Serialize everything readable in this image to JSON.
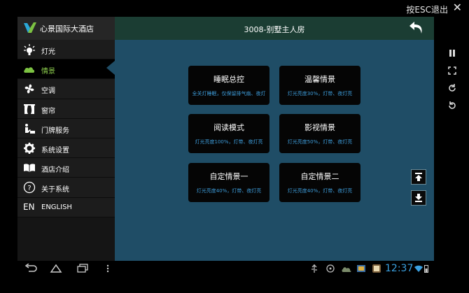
{
  "emulator": {
    "esc_hint": "按ESC退出",
    "close_glyph": "✕"
  },
  "brand": {
    "name": "心景国际大酒店",
    "logo": "v-logo-icon"
  },
  "header": {
    "room_title": "3008-别墅主人房"
  },
  "menu": {
    "active_index": 1,
    "items": [
      {
        "label": "灯光",
        "icon": "bulb-icon"
      },
      {
        "label": "情景",
        "icon": "scene-cloud-icon"
      },
      {
        "label": "空调",
        "icon": "fan-icon"
      },
      {
        "label": "窗帘",
        "icon": "curtain-icon"
      },
      {
        "label": "门牌服务",
        "icon": "doorbell-icon"
      },
      {
        "label": "系统设置",
        "icon": "gear-icon"
      },
      {
        "label": "酒店介绍",
        "icon": "book-icon"
      },
      {
        "label": "关于系统",
        "icon": "help-icon"
      },
      {
        "label": "ENGLISH",
        "icon": "EN"
      }
    ]
  },
  "scenes": [
    {
      "title": "睡眠总控",
      "desc": "全关灯睡眠，仅保留排气扇、夜灯"
    },
    {
      "title": "温馨情景",
      "desc": "灯光亮度30%，灯带、夜灯亮"
    },
    {
      "title": "阅读模式",
      "desc": "灯光亮度100%，灯带、夜灯亮"
    },
    {
      "title": "影视情景",
      "desc": "灯光亮度50%，灯带、夜灯亮"
    },
    {
      "title": "自定情景一",
      "desc": "灯光亮度40%，灯带、夜灯亮"
    },
    {
      "title": "自定情景二",
      "desc": "灯光亮度40%，灯带、夜灯亮"
    }
  ],
  "status_bar": {
    "time": "12:37"
  },
  "colors": {
    "active_green": "#8fd14f",
    "panel_blue": "#1f4d66",
    "header_green": "#1b3d33",
    "desc_blue": "#3d9bd8"
  }
}
